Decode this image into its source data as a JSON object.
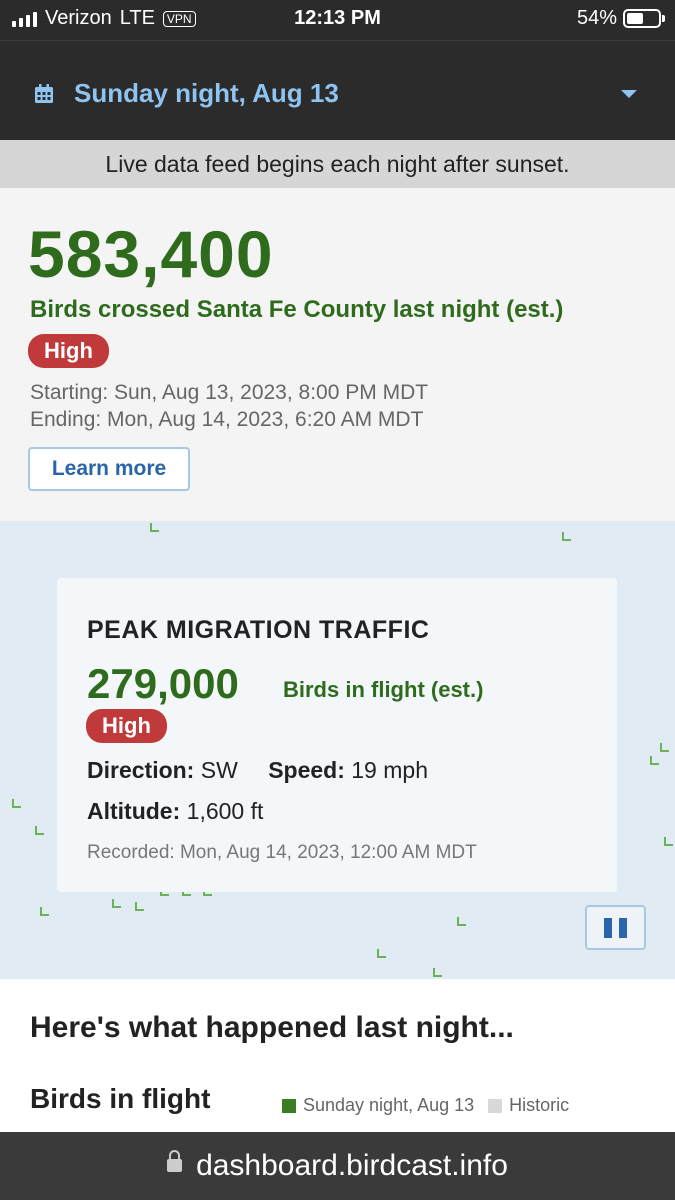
{
  "status": {
    "carrier": "Verizon",
    "network": "LTE",
    "vpn": "VPN",
    "time": "12:13 PM",
    "battery": "54%",
    "battery_level": 0.54
  },
  "date_selector": {
    "label": "Sunday night, Aug 13",
    "icon": "calendar-icon",
    "dropdown_icon": "chevron-down-icon"
  },
  "banner": {
    "text": "Live data feed begins each night after sunset."
  },
  "summary": {
    "count": "583,400",
    "caption": "Birds crossed Santa Fe County last night (est.)",
    "level": "High",
    "starting": "Starting: Sun, Aug 13, 2023, 8:00 PM MDT",
    "ending": "Ending: Mon, Aug 14, 2023, 6:20 AM MDT",
    "learn_more": "Learn more"
  },
  "peak": {
    "title": "PEAK MIGRATION TRAFFIC",
    "count": "279,000",
    "unit": "Birds in flight (est.)",
    "level": "High",
    "direction_label": "Direction:",
    "direction_value": "SW",
    "speed_label": "Speed:",
    "speed_value": "19 mph",
    "altitude_label": "Altitude:",
    "altitude_value": "1,600 ft",
    "recorded": "Recorded: Mon, Aug 14, 2023, 12:00 AM MDT"
  },
  "section": {
    "heading": "Here's what happened last night...",
    "flight_title": "Birds in flight",
    "legend": [
      {
        "label": "Sunday night, Aug 13",
        "color": "#3b7d23"
      },
      {
        "label": "Historic",
        "color": "#d8d8d8"
      }
    ]
  },
  "browser": {
    "url": "dashboard.birdcast.info"
  },
  "colors": {
    "accent_green": "#2e6b1c",
    "badge_red": "#c0393b",
    "link_blue": "#2a65a8",
    "date_blue": "#8ec4ef"
  }
}
